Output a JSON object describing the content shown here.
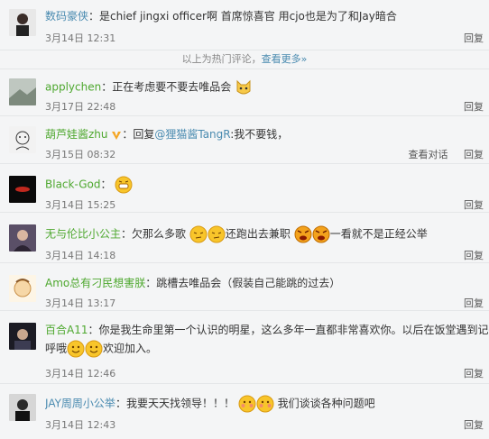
{
  "comments": [
    {
      "user": "数码豪侠",
      "text": "：是chief jingxi officer啊 首席惊喜官 用cjo也是为了和Jay暗合",
      "time": "3月14日 12:31",
      "reply": "回复"
    },
    {
      "user": "applychen",
      "text": "：正在考虑要不要去唯品会",
      "time": "3月17日 22:48",
      "reply": "回复"
    },
    {
      "user": "葫芦娃酱zhu",
      "text_pre": "：回复",
      "mention": "@狸猫酱TangR",
      "text_post": ":我不要钱，",
      "time": "3月15日 08:32",
      "view_convo": "查看对话",
      "reply": "回复"
    },
    {
      "user": "Black-God",
      "text": "：",
      "time": "3月14日 15:25",
      "reply": "回复"
    },
    {
      "user": "无与伦比小公主",
      "text_a": "：欠那么多歌",
      "text_b": "还跑出去兼职",
      "text_c": "一看就不是正经公举",
      "time": "3月14日 14:18",
      "reply": "回复"
    },
    {
      "user": "Amo总有刁民想害朕",
      "text": "：跳槽去唯品会（假装自己能跳的过去）",
      "time": "3月14日 13:17",
      "reply": "回复"
    },
    {
      "user": "百合A11",
      "text_line1": "：你是我生命里第一个认识的明星，这么多年一直都非常喜欢你。以后在饭堂遇到记得",
      "text_line2_pre": "呼哦",
      "text_line2_post": "欢迎加入。",
      "time": "3月14日 12:46",
      "reply": "回复"
    },
    {
      "user": "JAY周周小公举",
      "text_pre": "：我要天天找领导！！！",
      "text_post": " 我们谈谈各种问题吧",
      "time": "3月14日 12:43",
      "reply": "回复"
    }
  ],
  "hot_divider": {
    "label": "以上为热门评论，",
    "more": "查看更多»"
  },
  "colors": {
    "link": "#4a8bb0",
    "green_name": "#4ea82f",
    "background": "#f4f5f6"
  }
}
